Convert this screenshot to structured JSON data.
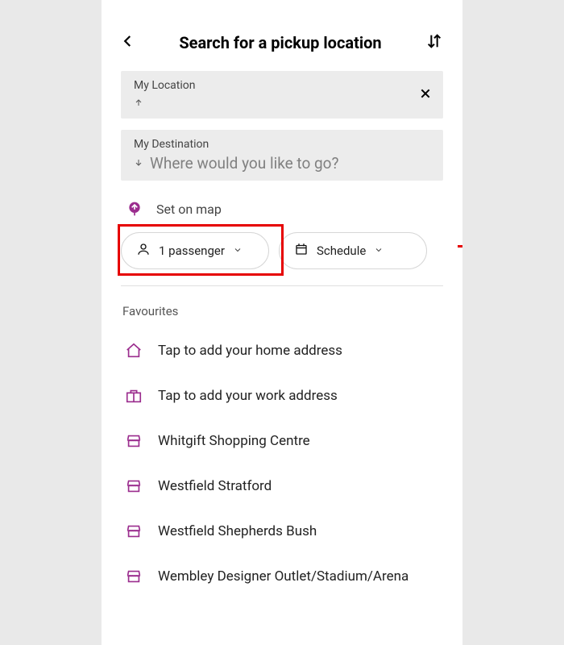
{
  "header": {
    "title": "Search for a pickup location"
  },
  "pickup": {
    "label": "My Location"
  },
  "destination": {
    "label": "My Destination",
    "placeholder": "Where would you like to go?"
  },
  "setOnMap": {
    "label": "Set on map"
  },
  "chips": {
    "passenger": "1 passenger",
    "schedule": "Schedule"
  },
  "favourites": {
    "title": "Favourites",
    "items": [
      {
        "icon": "home",
        "label": "Tap to add your home address"
      },
      {
        "icon": "work",
        "label": "Tap to add your work address"
      },
      {
        "icon": "shop",
        "label": "Whitgift Shopping Centre"
      },
      {
        "icon": "shop",
        "label": "Westfield Stratford"
      },
      {
        "icon": "shop",
        "label": "Westfield Shepherds Bush"
      },
      {
        "icon": "shop",
        "label": "Wembley Designer Outlet/Stadium/Arena"
      }
    ]
  },
  "colors": {
    "accent": "#9b2d8e",
    "highlight": "#e60000"
  }
}
